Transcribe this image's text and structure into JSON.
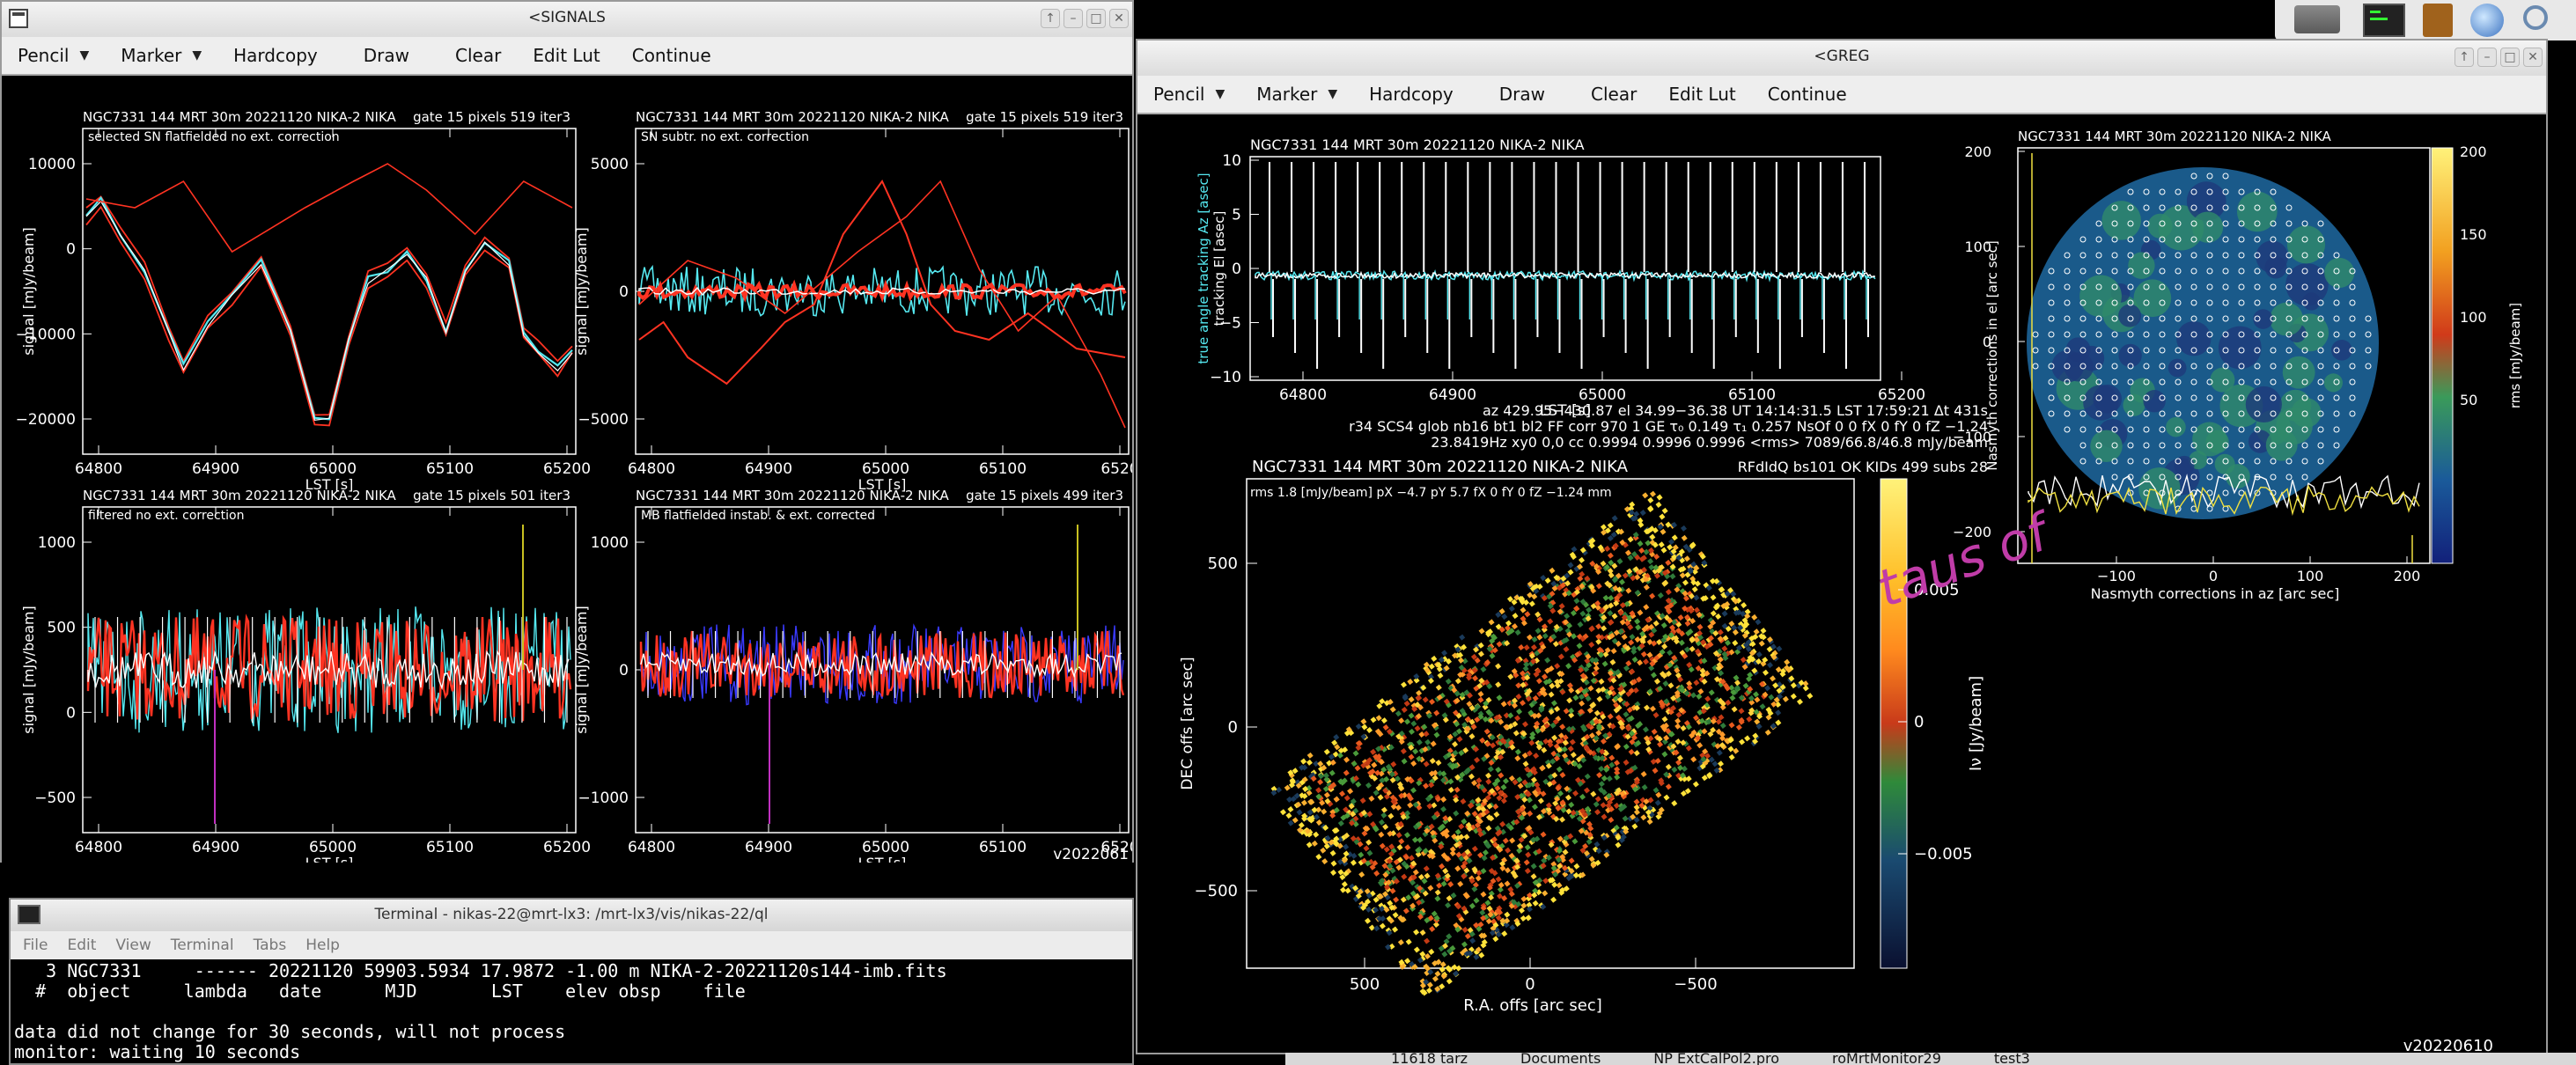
{
  "signals": {
    "title": "<SIGNALS",
    "menu": [
      {
        "label": "Pencil",
        "caret": true
      },
      {
        "label": "Marker",
        "caret": true
      },
      {
        "label": "Hardcopy",
        "caret": false
      },
      {
        "label": "Draw",
        "caret": false
      },
      {
        "label": "Clear",
        "caret": false
      },
      {
        "label": "Edit Lut",
        "caret": false
      },
      {
        "label": "Continue",
        "caret": false
      }
    ],
    "win_buttons": [
      "↑",
      "–",
      "□",
      "✕"
    ],
    "panels": [
      {
        "header": "NGC7331   144  MRT 30m   20221120  NIKA-2  NIKA",
        "pix": "gate 15 pixels 519 iter3",
        "subtitle": "selected SN flatfielded no ext. correction",
        "ylabel": "signal  [mJy/beam]",
        "xlabel": "LST [s]",
        "yticks": [
          "10000",
          "0",
          "−10000",
          "−20000"
        ],
        "xticks": [
          "64800",
          "64900",
          "65000",
          "65100",
          "65200"
        ]
      },
      {
        "header": "NGC7331   144  MRT 30m   20221120  NIKA-2  NIKA",
        "pix": "gate 15 pixels 519 iter3",
        "subtitle": "SN subtr. no ext. correction",
        "ylabel": "signal  [mJy/beam]",
        "xlabel": "LST [s]",
        "yticks": [
          "5000",
          "0",
          "−5000"
        ],
        "xticks": [
          "64800",
          "64900",
          "65000",
          "65100",
          "6520"
        ]
      },
      {
        "header": "NGC7331   144  MRT 30m   20221120  NIKA-2  NIKA",
        "pix": "gate 15 pixels 501 iter3",
        "subtitle": "filtered no ext. correction",
        "ylabel": "signal  [mJy/beam]",
        "xlabel": "LST [s]",
        "yticks": [
          "1000",
          "500",
          "0",
          "−500"
        ],
        "xticks": [
          "64800",
          "64900",
          "65000",
          "65100",
          "65200"
        ]
      },
      {
        "header": "NGC7331   144  MRT 30m   20221120  NIKA-2  NIKA",
        "pix": "gate 15 pixels 499 iter3",
        "subtitle": "MB flatfielded instab. & ext. corrected",
        "ylabel": "signal  [mJy/beam]",
        "xlabel": "LST [s]",
        "yticks": [
          "1000",
          "0",
          "−1000"
        ],
        "xticks": [
          "64800",
          "64900",
          "65000",
          "65100",
          "6520"
        ]
      }
    ],
    "version": "v2022061"
  },
  "greg": {
    "title": "<GREG",
    "menu": [
      {
        "label": "Pencil",
        "caret": true
      },
      {
        "label": "Marker",
        "caret": true
      },
      {
        "label": "Hardcopy",
        "caret": false
      },
      {
        "label": "Draw",
        "caret": false
      },
      {
        "label": "Clear",
        "caret": false
      },
      {
        "label": "Edit Lut",
        "caret": false
      },
      {
        "label": "Continue",
        "caret": false
      }
    ],
    "win_buttons": [
      "↑",
      "–",
      "□",
      "✕"
    ],
    "track": {
      "header": "NGC7331   144  MRT 30m   20221120  NIKA-2  NIKA",
      "ylabel1": "true angle tracking Az [asec]",
      "ylabel2": "tracking El [asec]",
      "xlabel": "LST [s]",
      "yticks": [
        "10",
        "5",
        "0",
        "−5",
        "−10"
      ],
      "xticks": [
        "64800",
        "64900",
        "65000",
        "65100",
        "65200"
      ]
    },
    "info": [
      "az 429.95−430.87  el 34.99−36.38  UT 14:14:31.5  LST 17:59:21  Δt 431s",
      "r34 SCS4 glob nb16 bt1 bl2 FF corr 970 1 GE τ₀ 0.149 τ₁ 0.257 NsOf 0 0 fX 0 fY 0 fZ −1.24",
      "23.8419Hz xy0 0,0 cc 0.9994 0.9996 0.9996 <rms> 7089/66.8/46.8 mJy/beam"
    ],
    "map": {
      "header": "NGC7331   144  MRT 30m   20221120  NIKA-2  NIKA",
      "flags": "RFdIdQ bs101  OK KIDs 499  subs 28",
      "rms": "rms 1.8 [mJy/beam]  pX −4.7 pY 5.7 fX 0 fY 0 fZ −1.24 mm",
      "ylabel": "DEC offs [arc sec]",
      "xlabel": "R.A. offs [arc sec]",
      "yticks": [
        "500",
        "0",
        "−500"
      ],
      "xticks": [
        "500",
        "0",
        "−500"
      ],
      "cb_label": "Iν [Jy/beam]",
      "cb_ticks": [
        "0.005",
        "0",
        "−0.005"
      ]
    },
    "nasmyth": {
      "header": "NGC7331   144  MRT 30m   20221120  NIKA-2  NIKA",
      "ylabel": "Nasmyth corrections in el [arc sec]",
      "xlabel": "Nasmyth corrections in az [arc sec]",
      "yticks": [
        "200",
        "100",
        "0",
        "−100",
        "−200"
      ],
      "xticks": [
        "−100",
        "0",
        "100",
        "200"
      ],
      "cb_label": "rms [mJy/beam]",
      "cb_ticks": [
        "200",
        "150",
        "100",
        "50"
      ]
    },
    "overlay_text": "taus of",
    "version": "v20220610"
  },
  "terminal": {
    "title": "Terminal - nikas-22@mrt-lx3: /mrt-lx3/vis/nikas-22/ql",
    "menu": [
      "File",
      "Edit",
      "View",
      "Terminal",
      "Tabs",
      "Help"
    ],
    "lines": [
      "   3 NGC7331     ------ 20221120 59903.5934 17.9872 -1.00 m NIKA-2-20221120s144-imb.fits",
      "  #  object     lambda   date      MJD       LST    elev obsp    file",
      "",
      "data did not change for 30 seconds, will not process",
      "monitor: waiting 10 seconds"
    ]
  },
  "taskbar": {
    "items": [
      "11618 tarz",
      "Documents",
      "NP ExtCalPol2.pro",
      "roMrtMonitor29",
      "test3"
    ]
  },
  "colors": {
    "plot_bg": "#000000",
    "series_red": "#ff3322",
    "series_cyan": "#55e8f0",
    "series_white": "#ffffff",
    "overlay_magenta": "#c03ca8"
  }
}
